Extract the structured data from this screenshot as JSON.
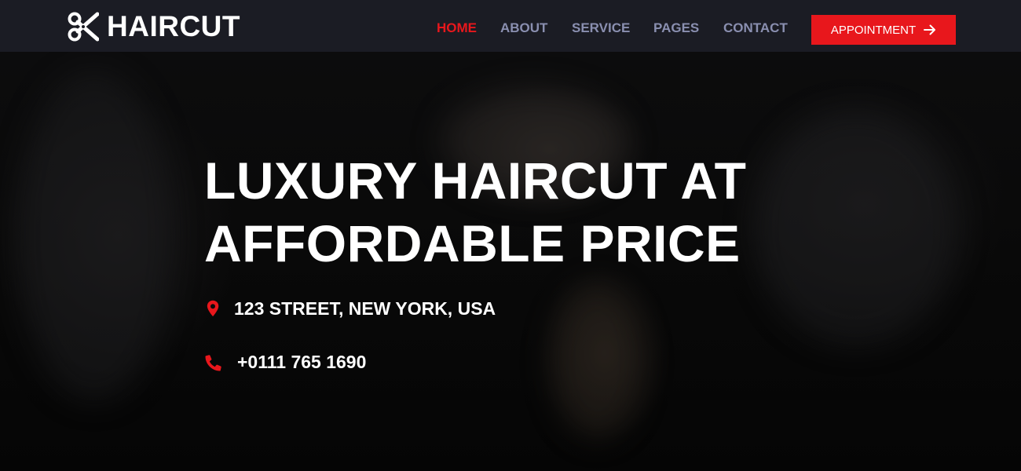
{
  "brand": {
    "name": "HAIRCUT",
    "icon": "scissors-icon",
    "icon_color": "#ffffff"
  },
  "nav": {
    "items": [
      {
        "label": "HOME",
        "active": true
      },
      {
        "label": "ABOUT",
        "active": false
      },
      {
        "label": "SERVICE",
        "active": false
      },
      {
        "label": "PAGES",
        "active": false
      },
      {
        "label": "CONTACT",
        "active": false
      }
    ],
    "cta": {
      "label": "APPOINTMENT",
      "icon": "arrow-right-icon"
    }
  },
  "hero": {
    "headline_line1": "LUXURY HAIRCUT AT",
    "headline_line2": "AFFORDABLE PRICE",
    "address": {
      "icon": "map-marker-icon",
      "text": "123 STREET, NEW YORK, USA"
    },
    "phone": {
      "icon": "phone-icon",
      "text": "+0111 765 1690"
    }
  },
  "colors": {
    "accent": "#e8171c",
    "navbar_bg": "#1b1c24",
    "nav_text": "#8a8fb0",
    "hero_text": "#ffffff"
  }
}
